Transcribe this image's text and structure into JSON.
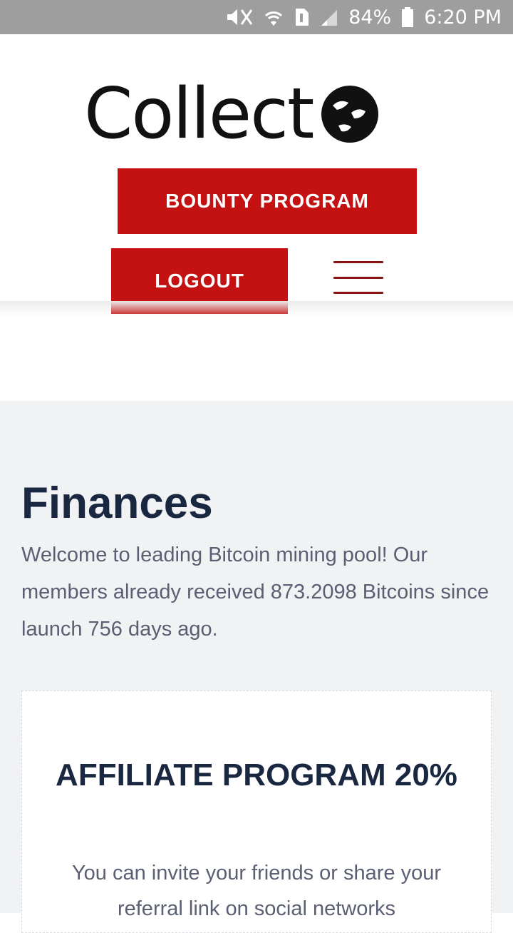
{
  "status_bar": {
    "battery": "84%",
    "time": "6:20 PM",
    "icons": [
      "mute-icon",
      "wifi-icon",
      "sim-icon",
      "signal-icon",
      "battery-icon"
    ]
  },
  "header": {
    "logo_text": "Collect",
    "bounty_button": "BOUNTY PROGRAM",
    "logout_button": "LOGOUT",
    "menu_icon": "hamburger-menu-icon"
  },
  "main": {
    "title": "Finances",
    "intro": "Welcome to leading Bitcoin mining pool! Our members already received 873.2098 Bitcoins since launch 756 days ago.",
    "card": {
      "title": "AFFILIATE PROGRAM 20%",
      "text": "You can invite your friends or share your referral link on social networks"
    }
  },
  "colors": {
    "accent": "#c41212",
    "heading": "#1a2740",
    "body_text": "#5a5f73",
    "content_bg": "#f1f2f4"
  }
}
